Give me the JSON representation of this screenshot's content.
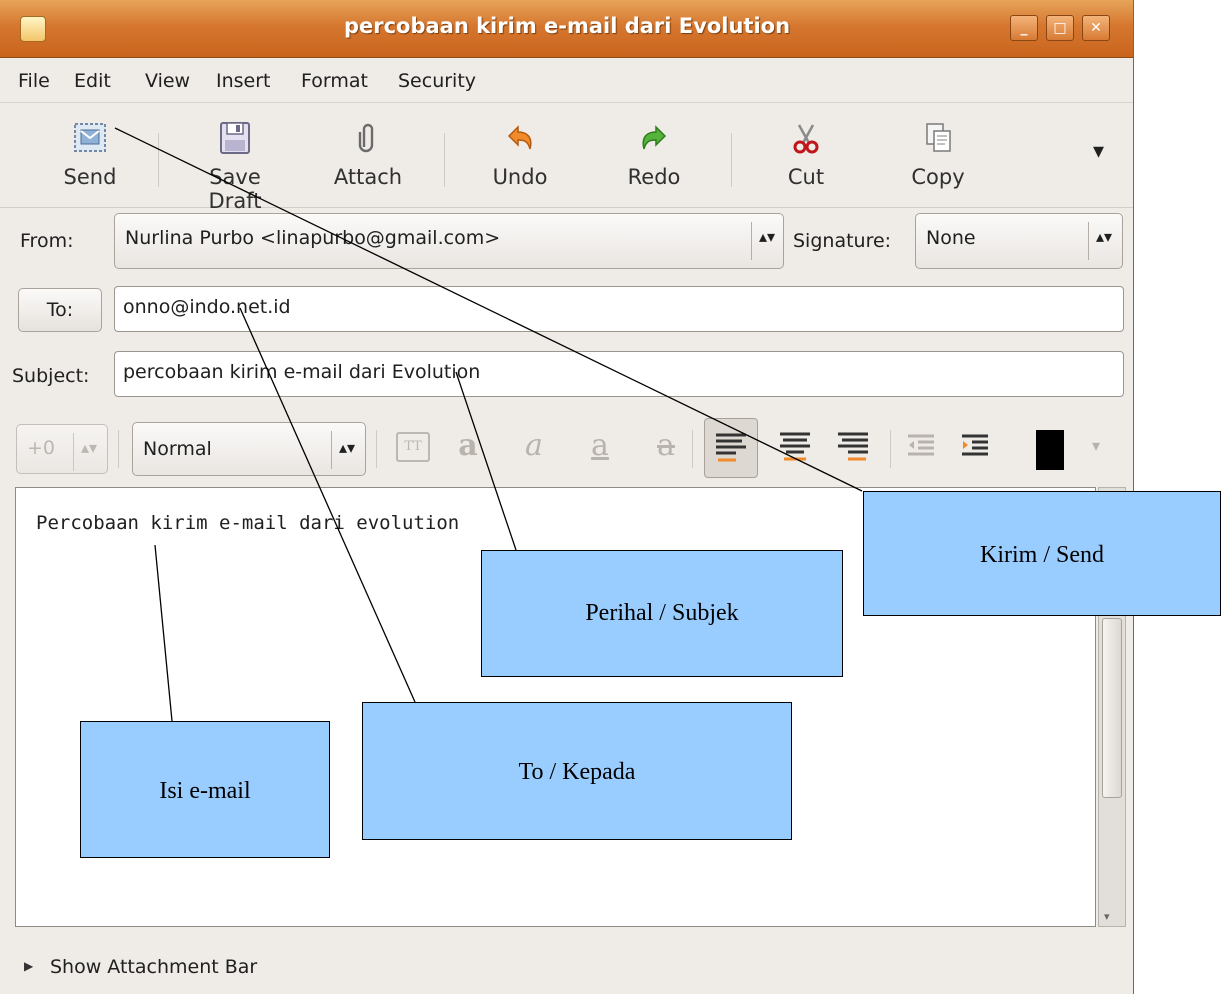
{
  "window": {
    "title": "percobaan kirim e-mail dari Evolution",
    "controls": {
      "minimize": "_",
      "maximize": "□",
      "close": "✕"
    }
  },
  "menu": [
    "File",
    "Edit",
    "View",
    "Insert",
    "Format",
    "Security"
  ],
  "toolbar": {
    "send": "Send",
    "save_draft": "Save Draft",
    "attach": "Attach",
    "undo": "Undo",
    "redo": "Redo",
    "cut": "Cut",
    "copy": "Copy",
    "overflow": "▾"
  },
  "from": {
    "label": "From:",
    "value": "Nurlina Purbo <linapurbo@gmail.com>"
  },
  "signature": {
    "label": "Signature:",
    "value": "None"
  },
  "to": {
    "button_label": "To:",
    "value": "onno@indo.net.id"
  },
  "subject": {
    "label": "Subject:",
    "value": "percobaan kirim e-mail dari Evolution"
  },
  "format_bar": {
    "font_size": "+0",
    "paragraph_style": "Normal"
  },
  "body": {
    "text": "Percobaan kirim e-mail dari evolution"
  },
  "status": {
    "attachment_toggle": "Show Attachment Bar"
  },
  "annotations": {
    "send": "Kirim / Send",
    "subject": "Perihal / Subjek",
    "to": "To / Kepada",
    "body": "Isi e-mail"
  },
  "colors": {
    "titlebar": "#d6772f",
    "callout_fill": "#99ccff",
    "window_bg": "#efebe7"
  }
}
